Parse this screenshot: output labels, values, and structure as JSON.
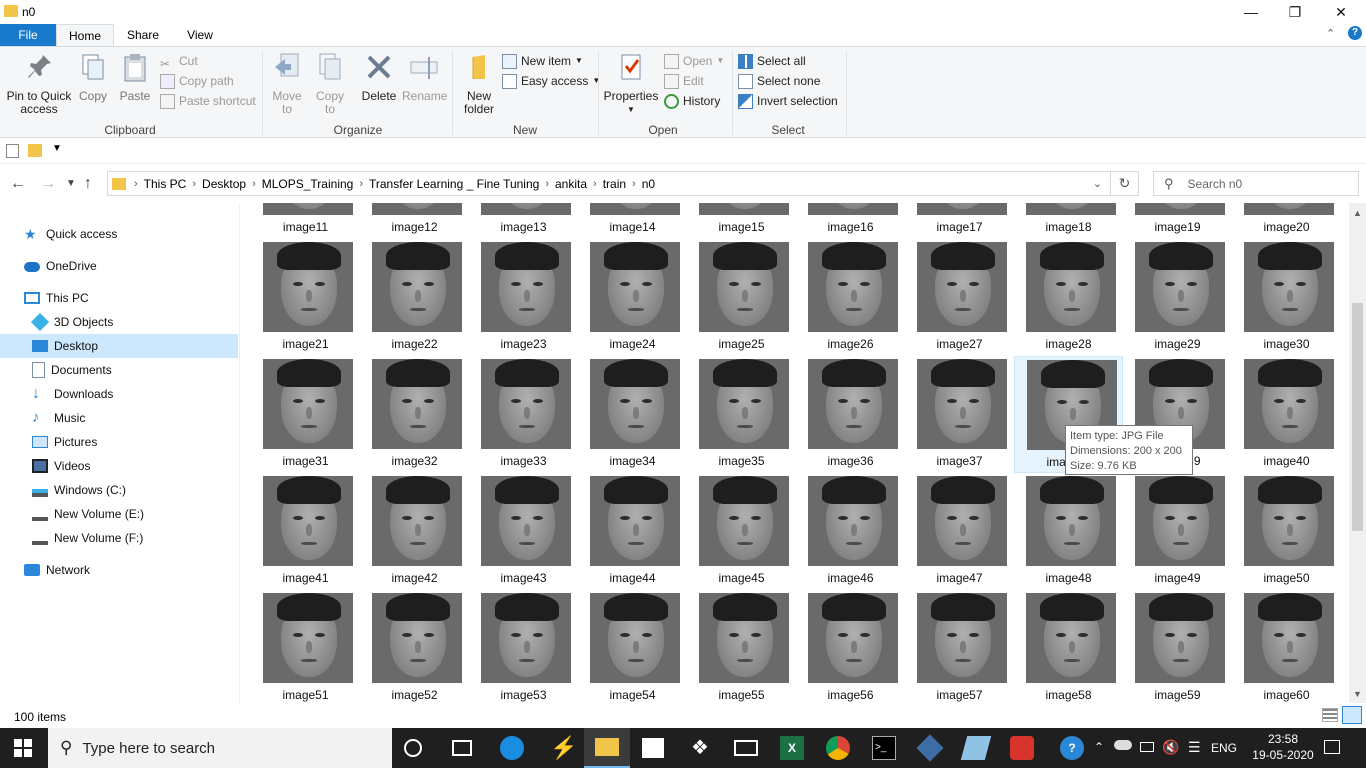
{
  "window": {
    "title": "n0"
  },
  "ribbon_tabs": [
    "File",
    "Home",
    "Share",
    "View"
  ],
  "clipboard": {
    "group": "Clipboard",
    "pin_label": "Pin to Quick access",
    "copy_label": "Copy",
    "paste_label": "Paste",
    "cut_label": "Cut",
    "copy_path_label": "Copy path",
    "paste_shortcut_label": "Paste shortcut"
  },
  "organize": {
    "group": "Organize",
    "move_label": "Move to",
    "copy_to_label": "Copy to",
    "delete_label": "Delete",
    "rename_label": "Rename"
  },
  "new": {
    "group": "New",
    "new_folder_label": "New folder",
    "new_item_label": "New item",
    "easy_access_label": "Easy access"
  },
  "open": {
    "group": "Open",
    "properties_label": "Properties",
    "open_label": "Open",
    "edit_label": "Edit",
    "history_label": "History"
  },
  "select": {
    "group": "Select",
    "select_all_label": "Select all",
    "select_none_label": "Select none",
    "invert_label": "Invert selection"
  },
  "breadcrumb": [
    "This PC",
    "Desktop",
    "MLOPS_Training",
    "Transfer Learning _ Fine Tuning",
    "ankita",
    "train",
    "n0"
  ],
  "search": {
    "placeholder": "Search n0"
  },
  "nav": [
    {
      "label": "Quick access",
      "icon": "star-icon"
    },
    {
      "label": "OneDrive",
      "icon": "cloud-icon"
    },
    {
      "label": "This PC",
      "icon": "computer-icon"
    },
    {
      "label": "3D Objects",
      "icon": "cube-icon"
    },
    {
      "label": "Desktop",
      "icon": "desktop-icon"
    },
    {
      "label": "Documents",
      "icon": "document-icon"
    },
    {
      "label": "Downloads",
      "icon": "download-icon"
    },
    {
      "label": "Music",
      "icon": "music-icon"
    },
    {
      "label": "Pictures",
      "icon": "pictures-icon"
    },
    {
      "label": "Videos",
      "icon": "videos-icon"
    },
    {
      "label": "Windows (C:)",
      "icon": "drive-icon"
    },
    {
      "label": "New Volume (E:)",
      "icon": "drive-icon"
    },
    {
      "label": "New Volume (F:)",
      "icon": "drive-icon"
    },
    {
      "label": "Network",
      "icon": "network-icon"
    }
  ],
  "files": {
    "row0": [
      "image11",
      "image12",
      "image13",
      "image14",
      "image15",
      "image16",
      "image17",
      "image18",
      "image19",
      "image20"
    ],
    "row1": [
      "image21",
      "image22",
      "image23",
      "image24",
      "image25",
      "image26",
      "image27",
      "image28",
      "image29",
      "image30"
    ],
    "row2": [
      "image31",
      "image32",
      "image33",
      "image34",
      "image35",
      "image36",
      "image37",
      "image38",
      "image39",
      "image40"
    ],
    "row3": [
      "image41",
      "image42",
      "image43",
      "image44",
      "image45",
      "image46",
      "image47",
      "image48",
      "image49",
      "image50"
    ],
    "row4": [
      "image51",
      "image52",
      "image53",
      "image54",
      "image55",
      "image56",
      "image57",
      "image58",
      "image59",
      "image60"
    ]
  },
  "tooltip": {
    "type": "Item type: JPG File",
    "dimensions": "Dimensions: 200 x 200",
    "size": "Size: 9.76 KB"
  },
  "status": {
    "items": "100 items"
  },
  "taskbar": {
    "search_placeholder": "Type here to search",
    "lang": "ENG",
    "time": "23:58",
    "date": "19-05-2020"
  },
  "colors": {
    "accent": "#1979ca",
    "selected": "#cce8ff",
    "taskbar": "#1f1f1f"
  }
}
